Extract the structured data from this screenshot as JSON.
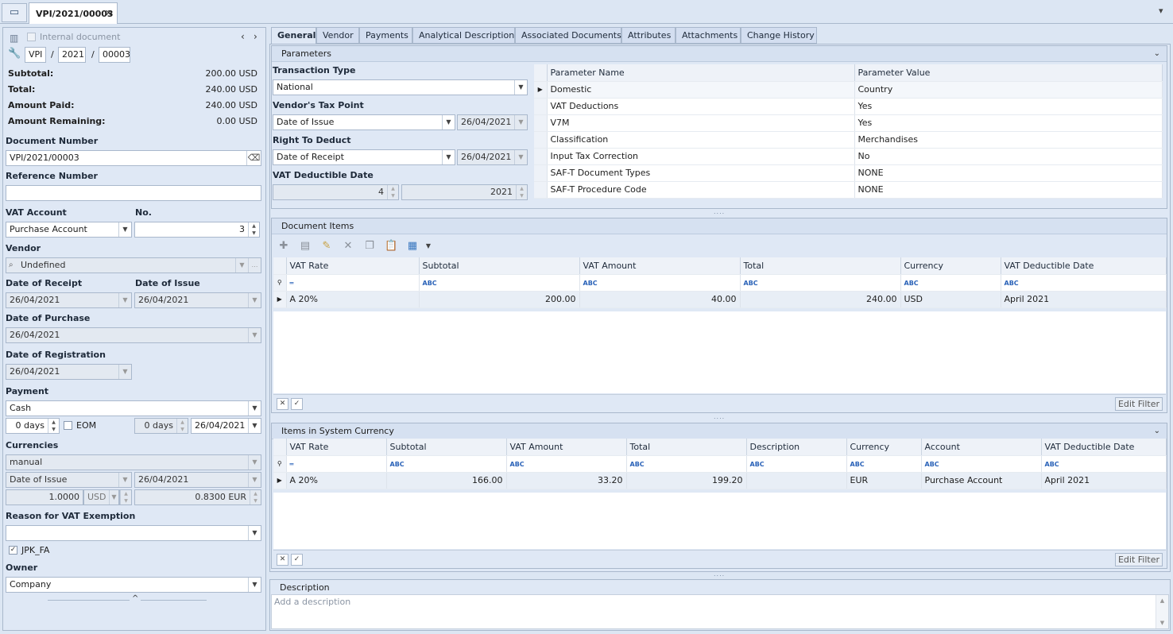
{
  "window": {
    "doc_tab": "VPI/2021/00003",
    "close": "✕",
    "menu": "▾"
  },
  "left": {
    "internal_document": "Internal document",
    "series": "VPI",
    "year": "2021",
    "number": "00003",
    "slash": "/",
    "subtotal_label": "Subtotal:",
    "subtotal_value": "200.00 USD",
    "total_label": "Total:",
    "total_value": "240.00 USD",
    "amount_paid_label": "Amount Paid:",
    "amount_paid_value": "240.00 USD",
    "amount_remaining_label": "Amount Remaining:",
    "amount_remaining_value": "0.00 USD",
    "document_number_label": "Document Number",
    "document_number_value": "VPI/2021/00003",
    "reference_number_label": "Reference Number",
    "reference_number_value": "",
    "vat_account_label": "VAT Account",
    "vat_account_value": "Purchase Account",
    "no_label": "No.",
    "no_value": "3",
    "vendor_label": "Vendor",
    "vendor_value": "Undefined",
    "date_of_receipt_label": "Date of Receipt",
    "date_of_receipt_value": "26/04/2021",
    "date_of_issue_label": "Date of Issue",
    "date_of_issue_value": "26/04/2021",
    "date_of_purchase_label": "Date of Purchase",
    "date_of_purchase_value": "26/04/2021",
    "date_of_registration_label": "Date of Registration",
    "date_of_registration_value": "26/04/2021",
    "payment_label": "Payment",
    "payment_value": "Cash",
    "days1": "0 days",
    "eom_label": "EOM",
    "days2": "0 days",
    "payment_date": "26/04/2021",
    "currencies_label": "Currencies",
    "currencies_mode": "manual",
    "currency_date_type": "Date of Issue",
    "currency_date": "26/04/2021",
    "rate_amount": "1.0000",
    "rate_currency": "USD",
    "rate_value": "0.8300 EUR",
    "vat_exemption_label": "Reason for VAT Exemption",
    "vat_exemption_value": "",
    "jpk_label": "JPK_FA",
    "owner_label": "Owner",
    "owner_value": "Company",
    "collapse": "^"
  },
  "tabs": [
    "General",
    "Vendor",
    "Payments",
    "Analytical Description",
    "Associated Documents",
    "Attributes",
    "Attachments",
    "Change History"
  ],
  "parameters": {
    "title": "Parameters",
    "transaction_type_label": "Transaction Type",
    "transaction_type_value": "National",
    "vendors_tax_point_label": "Vendor's Tax Point",
    "vendors_tax_point_value": "Date of Issue",
    "vendors_tax_point_date": "26/04/2021",
    "right_to_deduct_label": "Right To Deduct",
    "right_to_deduct_value": "Date of Receipt",
    "right_to_deduct_date": "26/04/2021",
    "vat_deductible_date_label": "VAT Deductible Date",
    "vat_deductible_month": "4",
    "vat_deductible_year": "2021",
    "grid_headers": [
      "Parameter Name",
      "Parameter Value"
    ],
    "grid_rows": [
      [
        "Domestic",
        "Country"
      ],
      [
        "VAT Deductions",
        "Yes"
      ],
      [
        "V7M",
        "Yes"
      ],
      [
        "Classification",
        "Merchandises"
      ],
      [
        "Input Tax Correction",
        "No"
      ],
      [
        "SAF-T Document Types",
        "NONE"
      ],
      [
        "SAF-T Procedure Code",
        "NONE"
      ]
    ]
  },
  "document_items": {
    "title": "Document Items",
    "headers": [
      "VAT Rate",
      "Subtotal",
      "VAT Amount",
      "Total",
      "Currency",
      "VAT Deductible Date"
    ],
    "rows": [
      [
        "A 20%",
        "200.00",
        "40.00",
        "240.00",
        "USD",
        "April 2021"
      ]
    ],
    "edit_filter": "Edit Filter"
  },
  "system_items": {
    "title": "Items in System Currency",
    "headers": [
      "VAT Rate",
      "Subtotal",
      "VAT Amount",
      "Total",
      "Description",
      "Currency",
      "Account",
      "VAT Deductible Date"
    ],
    "rows": [
      [
        "A 20%",
        "166.00",
        "33.20",
        "199.20",
        "",
        "EUR",
        "Purchase Account",
        "April 2021"
      ]
    ],
    "edit_filter": "Edit Filter"
  },
  "description": {
    "title": "Description",
    "placeholder": "Add a description"
  }
}
